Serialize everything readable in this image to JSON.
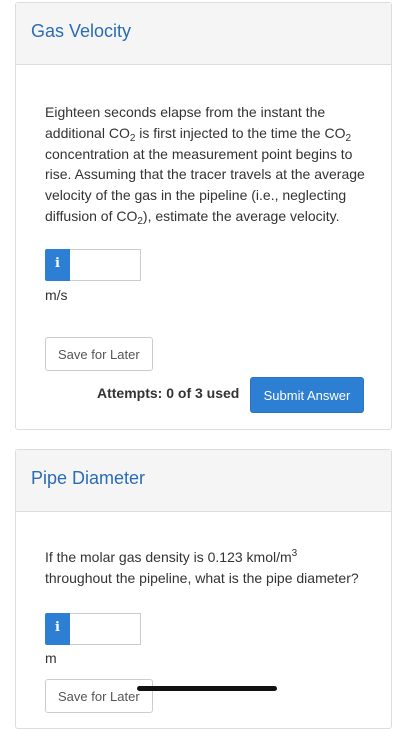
{
  "questions": [
    {
      "title": "Gas Velocity",
      "text_parts": [
        "Eighteen seconds elapse from the instant the additional CO",
        "2",
        " is first injected to the time the CO",
        "2",
        " concentration at the measurement point begins to rise. Assuming that the tracer travels at the average velocity of the gas in the pipeline (i.e., neglecting diffusion of CO",
        "2",
        "), estimate the average velocity."
      ],
      "info_icon": "info-icon",
      "info_glyph": "i",
      "answer_value": "",
      "unit": "m/s",
      "save_label": "Save for Later",
      "attempts_text": "Attempts: 0 of 3 used",
      "submit_label": "Submit Answer"
    },
    {
      "title": "Pipe Diameter",
      "text_parts": [
        "If the molar gas density is 0.123 kmol/m",
        "3",
        " throughout the pipeline, what is the pipe diameter?"
      ],
      "info_icon": "info-icon",
      "info_glyph": "i",
      "answer_value": "",
      "unit": "m",
      "save_label": "Save for Later"
    }
  ],
  "colors": {
    "title": "#2a6cb5",
    "accent": "#2d7fd3",
    "header_bg": "#f5f5f5",
    "border": "#dddddd"
  }
}
